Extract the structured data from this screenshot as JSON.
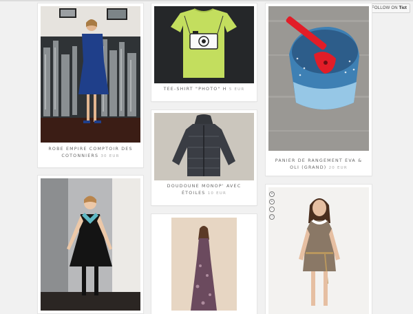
{
  "header": {
    "follow_label": "FOLLOW ON",
    "follow_brand": "Tict"
  },
  "products": [
    {
      "title": "Robe empire Comptoir des Cotonniers",
      "price": "30 EUR"
    },
    {
      "title": "Tee-shirt \"photo\" H",
      "price": "5 EUR"
    },
    {
      "title": "Panier de rangement Eva & Oli (grand)",
      "price": "20 EUR"
    },
    {
      "title": "Doudoune Monop' avec étoiles",
      "price": "10 EUR"
    }
  ],
  "icons": [
    "close-icon",
    "zoom-in-icon",
    "zoom-out-icon",
    "fullscreen-icon"
  ]
}
